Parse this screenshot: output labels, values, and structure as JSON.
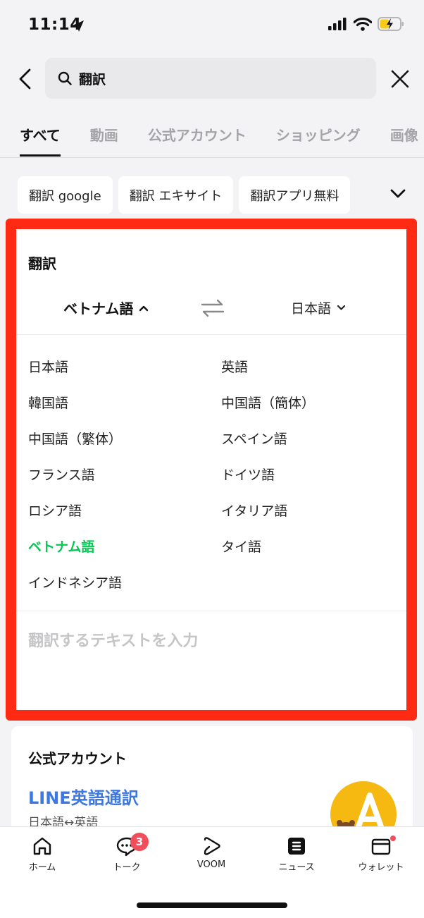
{
  "status_bar": {
    "time": "11:14"
  },
  "search": {
    "query": "翻訳",
    "placeholder": ""
  },
  "tabs": [
    {
      "label": "すべて",
      "active": true
    },
    {
      "label": "動画"
    },
    {
      "label": "公式アカウント"
    },
    {
      "label": "ショッピング"
    },
    {
      "label": "画像"
    }
  ],
  "chips": [
    "翻訳 google",
    "翻訳 エキサイト",
    "翻訳アプリ無料"
  ],
  "translator": {
    "title": "翻訳",
    "source_lang": "ベトナム語",
    "target_lang": "日本語",
    "languages_left": [
      "日本語",
      "韓国語",
      "中国語（繁体）",
      "フランス語",
      "ロシア語",
      "ベトナム語",
      "インドネシア語"
    ],
    "languages_right": [
      "英語",
      "中国語（簡体）",
      "スペイン語",
      "ドイツ語",
      "イタリア語",
      "タイ語"
    ],
    "selected_language": "ベトナム語",
    "input_placeholder": "翻訳するテキストを入力"
  },
  "official_account": {
    "heading": "公式アカウント",
    "name": "LINE英語通訳",
    "description": "日本語↔英語"
  },
  "bottom_nav": [
    {
      "label": "ホーム",
      "icon": "home-icon"
    },
    {
      "label": "トーク",
      "icon": "chat-icon",
      "badge": "3"
    },
    {
      "label": "VOOM",
      "icon": "voom-icon"
    },
    {
      "label": "ニュース",
      "icon": "news-icon"
    },
    {
      "label": "ウォレット",
      "icon": "wallet-icon",
      "dot": true
    }
  ],
  "colors": {
    "highlight": "#ff2a14",
    "selected_green": "#06c755",
    "link_blue": "#3c78e0",
    "badge_red": "#f04e5a"
  }
}
